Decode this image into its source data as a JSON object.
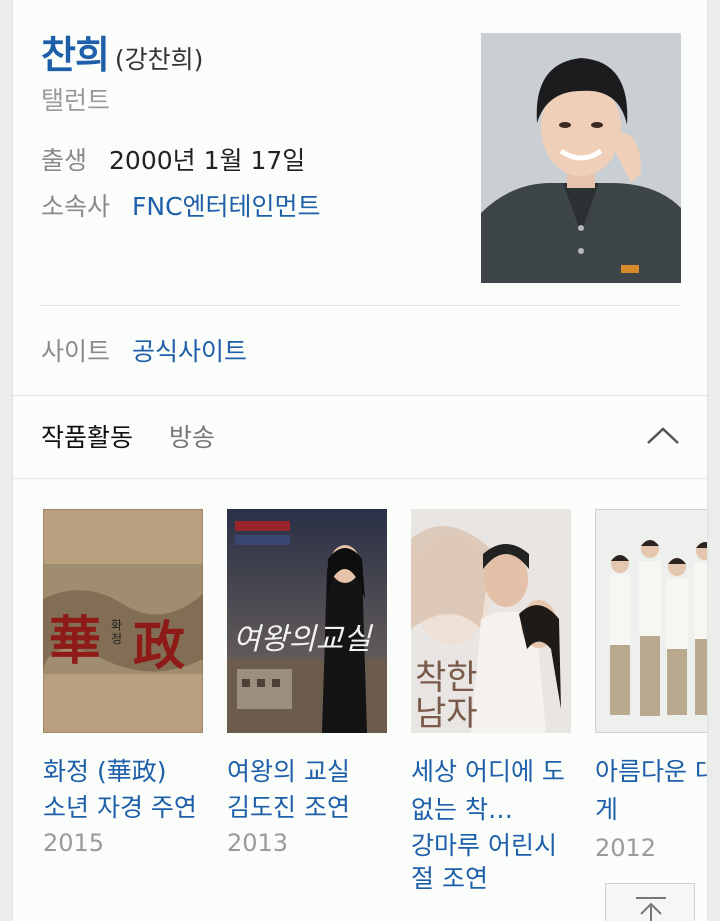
{
  "profile": {
    "name": "찬희",
    "real_name": "(강찬희)",
    "job": "탤런트",
    "birth_label": "출생",
    "birth_value": "2000년 1월 17일",
    "agency_label": "소속사",
    "agency_value": "FNC엔터테인먼트",
    "site_label": "사이트",
    "site_value": "공식사이트"
  },
  "section": {
    "title": "작품활동",
    "tab": "방송",
    "collapse_icon": "chevron-up-icon"
  },
  "works": [
    {
      "title": "화정 (華政)",
      "role": "소년 자경 주연",
      "year": "2015",
      "poster_text": "華政"
    },
    {
      "title": "여왕의 교실",
      "role": "김도진 조연",
      "year": "2013",
      "poster_text": "여왕의교실"
    },
    {
      "title": "세상 어디에 도 없는 착…",
      "role": "강마루 어린시 절 조연",
      "year": "",
      "poster_text": "착한남자"
    },
    {
      "title": "아름다운 대에게",
      "role": "",
      "year": "2012",
      "poster_text": ""
    }
  ],
  "scroll_top_icon": "arrow-up-icon",
  "colors": {
    "link": "#1d5fa8",
    "label": "#8a8a8a"
  }
}
